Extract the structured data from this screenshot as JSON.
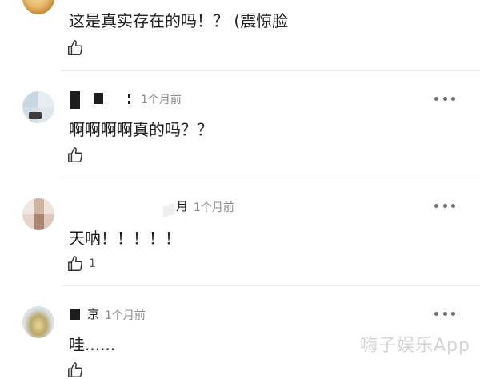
{
  "comments": [
    {
      "username": "",
      "time": "",
      "text": "这是真实存在的吗！？ (震惊脸",
      "likes": ""
    },
    {
      "username": "",
      "time": "1个月前",
      "text": "啊啊啊啊真的吗？？",
      "likes": ""
    },
    {
      "username": "月",
      "time": "1个月前",
      "text": "天呐！！！！！",
      "likes": "1"
    },
    {
      "username": "京",
      "time": "1个月前",
      "text": "哇......",
      "likes": ""
    }
  ],
  "watermark": "嗨子娱乐App",
  "icons": [
    "thumbs-up-icon",
    "more-icon"
  ],
  "colors": {
    "text": "#222222",
    "meta": "#8a8a8a",
    "divider": "#e9e9e9"
  }
}
